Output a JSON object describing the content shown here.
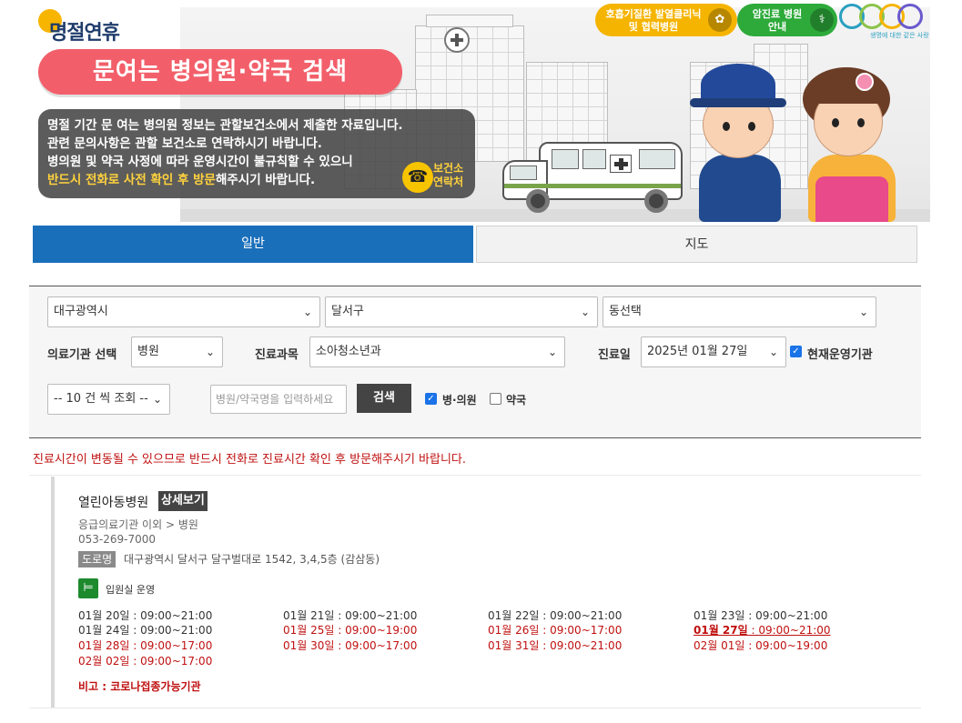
{
  "banner": {
    "brand": "명절연휴",
    "title": "문여는 병의원·약국 검색",
    "notice": {
      "line1": "명절 기간 문 여는 병의원 정보는 관할보건소에서 제출한 자료입니다.",
      "line2": "관련 문의사항은 관할 보건소로 연락하시기 바랍니다.",
      "line3": "병의원 및 약국 사정에 따라 운영시간이 불규칙할 수 있으니",
      "line4_highlight": "반드시 전화로 사전 확인 후 방문",
      "line4_rest": "해주시기 바랍니다."
    },
    "health_center_contact": "보건소 연락처",
    "top_buttons": {
      "respiratory": "호흡기질환 발열클리닉 및 협력병원",
      "cancer": "암진료 병원안내"
    },
    "egen_subtitle": "생명에 대한 같은 사랑",
    "colors": {
      "title_pill": "#f25f6a",
      "yellow": "#f5b400",
      "green": "#2daa3a"
    }
  },
  "tabs": {
    "general": "일반",
    "map": "지도"
  },
  "search": {
    "city": "대구광역시",
    "district": "달서구",
    "dong": "동선택",
    "facility_label": "의료기관 선택",
    "facility_value": "병원",
    "dept_label": "진료과목",
    "dept_value": "소아청소년과",
    "date_label": "진료일",
    "date_value": "2025년 01월 27일",
    "open_now_label": "현재운영기관",
    "page_size": "-- 10 건 씩 조회 --",
    "name_placeholder": "병원/약국명을 입력하세요",
    "search_button": "검색",
    "clinic_label": "병·의원",
    "pharmacy_label": "약국"
  },
  "warning": "진료시간이 변동될 수 있으므로 반드시 전화로 진료시간 확인 후 방문해주시기 바랍니다.",
  "result": {
    "name": "열린아동병원",
    "detail_button": "상세보기",
    "category": "응급의료기관 이외 > 병원",
    "phone": "053-269-7000",
    "road_tag": "도로명",
    "address": "대구광역시 달서구 달구벌대로 1542, 3,4,5층 (감삼동)",
    "ward_label": "입원실 운영",
    "hours": [
      {
        "date": "01월 20일",
        "time": " : 09:00~21:00",
        "style": "normal"
      },
      {
        "date": "01월 21일",
        "time": " : 09:00~21:00",
        "style": "normal"
      },
      {
        "date": "01월 22일",
        "time": " : 09:00~21:00",
        "style": "normal"
      },
      {
        "date": "01월 23일",
        "time": " : 09:00~21:00",
        "style": "normal"
      },
      {
        "date": "01월 24일",
        "time": " : 09:00~21:00",
        "style": "normal"
      },
      {
        "date": "01월 25일",
        "time": " : 09:00~19:00",
        "style": "red"
      },
      {
        "date": "01월 26일",
        "time": " : 09:00~17:00",
        "style": "red"
      },
      {
        "date": "01월 27일",
        "time": " : 09:00~21:00",
        "style": "today"
      },
      {
        "date": "01월 28일",
        "time": " : 09:00~17:00",
        "style": "red"
      },
      {
        "date": "01월 30일",
        "time": " : 09:00~17:00",
        "style": "red"
      },
      {
        "date": "01월 31일",
        "time": " : 09:00~21:00",
        "style": "red"
      },
      {
        "date": "02월 01일",
        "time": " : 09:00~19:00",
        "style": "red"
      },
      {
        "date": "02월 02일",
        "time": " : 09:00~17:00",
        "style": "red"
      }
    ],
    "remark": "비고 : 코로나접종가능기관"
  }
}
